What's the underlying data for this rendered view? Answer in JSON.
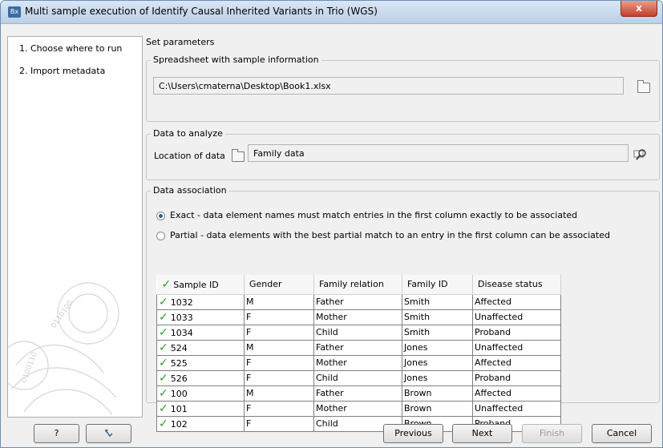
{
  "window": {
    "app_icon": "Bx",
    "title": "Multi sample execution of Identify Causal Inherited Variants in Trio (WGS)",
    "close_label": "x"
  },
  "steps": [
    {
      "label": "1.  Choose where to run"
    },
    {
      "label": "2.  Import metadata"
    }
  ],
  "main": {
    "heading": "Set parameters",
    "spreadsheet": {
      "group_label": "Spreadsheet with sample information",
      "path": "C:\\Users\\cmaterna\\Desktop\\Book1.xlsx"
    },
    "data_to_analyze": {
      "group_label": "Data to analyze",
      "location_label": "Location of data",
      "location_value": "Family data"
    },
    "association": {
      "group_label": "Data association",
      "exact_label": "Exact - data element names must match entries in the first column exactly to be associated",
      "partial_label": "Partial - data elements with the best partial match to an entry in the first column can be associated",
      "selected": "exact"
    },
    "table": {
      "headers": [
        "Sample ID",
        "Gender",
        "Family relation",
        "Family ID",
        "Disease status"
      ],
      "rows": [
        [
          "1032",
          "M",
          "Father",
          "Smith",
          "Affected"
        ],
        [
          "1033",
          "F",
          "Mother",
          "Smith",
          "Unaffected"
        ],
        [
          "1034",
          "F",
          "Child",
          "Smith",
          "Proband"
        ],
        [
          "524",
          "M",
          "Father",
          "Jones",
          "Unaffected"
        ],
        [
          "525",
          "F",
          "Mother",
          "Jones",
          "Affected"
        ],
        [
          "526",
          "F",
          "Child",
          "Jones",
          "Proband"
        ],
        [
          "100",
          "M",
          "Father",
          "Brown",
          "Affected"
        ],
        [
          "101",
          "F",
          "Mother",
          "Brown",
          "Unaffected"
        ],
        [
          "102",
          "F",
          "Child",
          "Brown",
          "Proband"
        ]
      ]
    }
  },
  "buttons": {
    "help": "?",
    "previous": "Previous",
    "next": "Next",
    "finish": "Finish",
    "cancel": "Cancel"
  },
  "colors": {
    "check": "#2c9a2c",
    "title_bar": "#bccfe6",
    "close_button": "#c4402a"
  }
}
